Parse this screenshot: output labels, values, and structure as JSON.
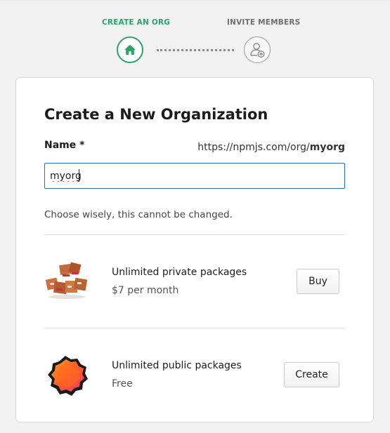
{
  "stepper": {
    "steps": [
      {
        "label": "CREATE AN ORG",
        "icon": "home-icon",
        "status": "active",
        "color": "#2aa36a"
      },
      {
        "label": "INVITE MEMBERS",
        "icon": "add-user-icon",
        "status": "inactive",
        "color": "#6f6f6f"
      }
    ]
  },
  "form": {
    "title": "Create a New Organization",
    "name_label": "Name *",
    "url_prefix": "https://npmjs.com/org/",
    "url_org": "myorg",
    "name_value": "myorg",
    "hint": "Choose wisely, this cannot be changed."
  },
  "plans": [
    {
      "title": "Unlimited private packages",
      "subtitle": "$7 per month",
      "button_label": "Buy",
      "image": "private-packages-illustration"
    },
    {
      "title": "Unlimited public packages",
      "subtitle": "Free",
      "button_label": "Create",
      "image": "public-packages-badge"
    }
  ],
  "colors": {
    "accent_green": "#2aa36a",
    "input_border": "#2c6cb5",
    "spellcheck_red": "#d0021b"
  }
}
